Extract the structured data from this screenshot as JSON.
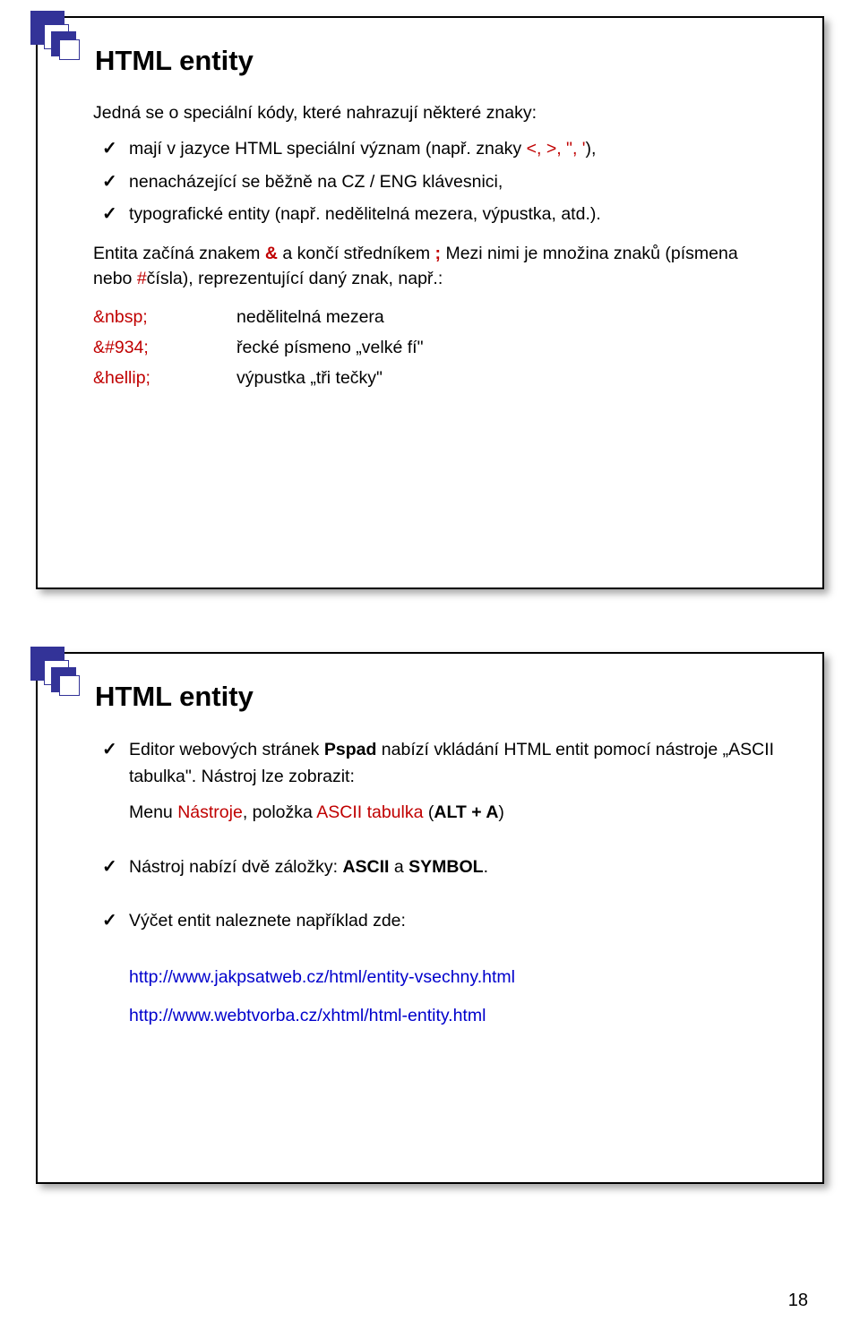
{
  "page_number": "18",
  "slide1": {
    "title": "HTML entity",
    "intro": "Jedná se o speciální kódy, které nahrazují některé znaky:",
    "bullets": [
      {
        "pre": "mají v jazyce HTML speciální význam (např. znaky ",
        "red": "<, >, \", '",
        "post": "),"
      },
      {
        "pre": "nenacházející se běžně na CZ / ENG klávesnici,"
      },
      {
        "pre": "typografické entity (např. nedělitelná mezera, výpustka, atd.)."
      }
    ],
    "explain": {
      "p1a": "Entita začíná znakem ",
      "amp": "&",
      "p1b": " a končí středníkem ",
      "semi": ";",
      "p1c": " Mezi nimi je množina znaků (písmena nebo ",
      "hash": "#",
      "p1d": "čísla), reprezentující daný znak, např.:"
    },
    "examples": [
      {
        "key": "&nbsp;",
        "val": "nedělitelná mezera"
      },
      {
        "key": "&#934;",
        "val": "řecké písmeno „velké fí\""
      },
      {
        "key": "&hellip;",
        "val": "výpustka „tři tečky\""
      }
    ]
  },
  "slide2": {
    "title": "HTML entity",
    "item1": {
      "a": "Editor webových stránek ",
      "b": "Pspad",
      "c": " nabízí vkládání HTML entit pomocí nástroje „ASCII tabulka\". Nástroj lze zobrazit:",
      "sub_a": "Menu ",
      "sub_b": "Nástroje",
      "sub_c": ", položka ",
      "sub_d": "ASCII tabulka",
      "sub_e": " (",
      "sub_f": "ALT + A",
      "sub_g": ")"
    },
    "item2": {
      "a": "Nástroj nabízí dvě záložky: ",
      "b": "ASCII",
      "c": " a ",
      "d": "SYMBOL",
      "e": "."
    },
    "item3": "Výčet entit naleznete například zde:",
    "links": [
      "http://www.jakpsatweb.cz/html/entity-vsechny.html",
      "http://www.webtvorba.cz/xhtml/html-entity.html"
    ]
  }
}
